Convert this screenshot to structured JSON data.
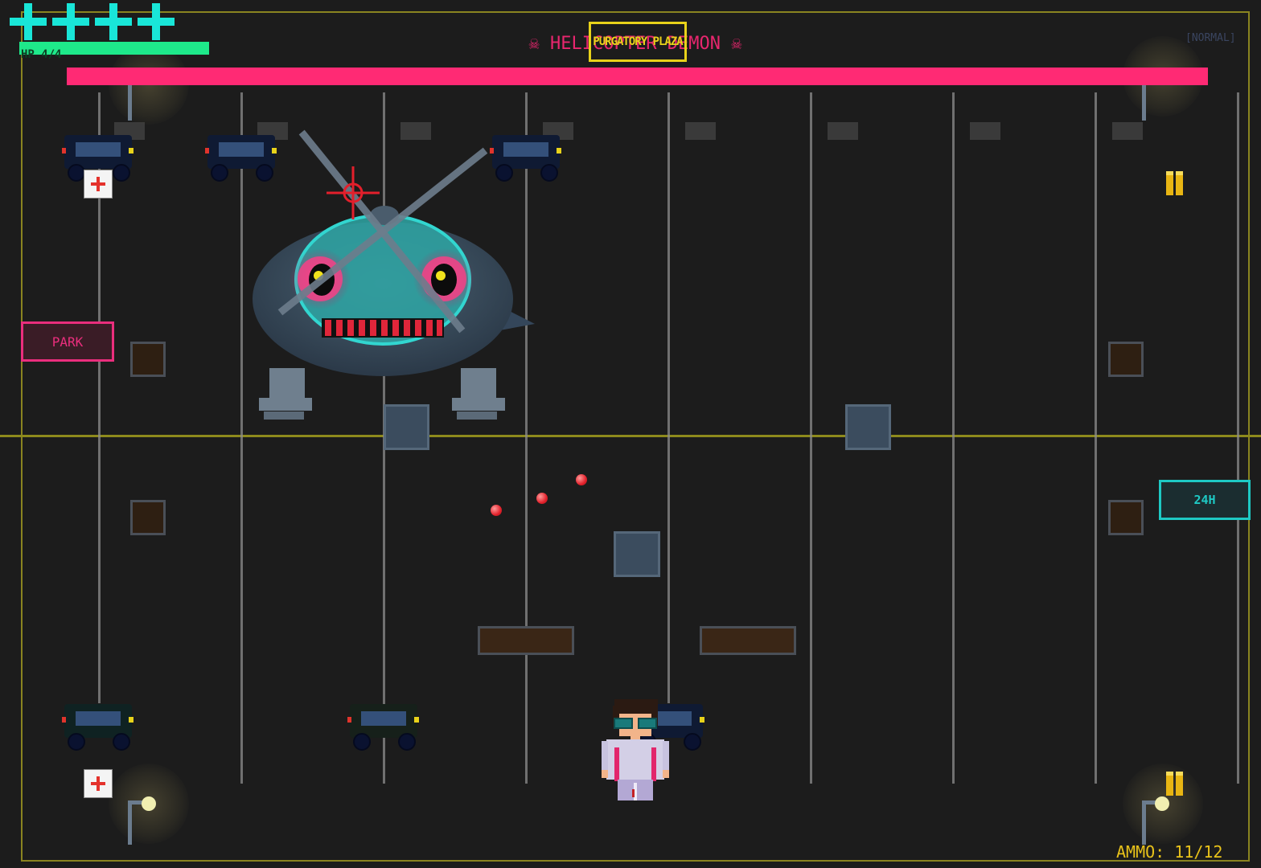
{
  "hud": {
    "lives": 4,
    "hp_label": "HP 4/4",
    "hp_fraction": 1.0,
    "boss_title": "☠ HELICOPTER DEMON ☠",
    "boss_hp_fraction": 1.0,
    "level_name": "PURGATORY PLAZA",
    "difficulty": "[NORMAL]",
    "ammo_label": "AMMO: 11/12"
  },
  "signs": {
    "park": "PARK",
    "store": "24H"
  },
  "colors": {
    "hud_cyan": "#19e6d8",
    "hp_green": "#1ee98a",
    "boss_pink": "#ff2a74",
    "border_yellow": "#8a8420",
    "ammo_yellow": "#e8c21a"
  },
  "icons": {
    "life": "plus-cross-icon",
    "medkit": "medkit-icon",
    "crosshair": "crosshair-icon",
    "ammo": "ammo-icon",
    "boss_skull": "skull-icon"
  }
}
